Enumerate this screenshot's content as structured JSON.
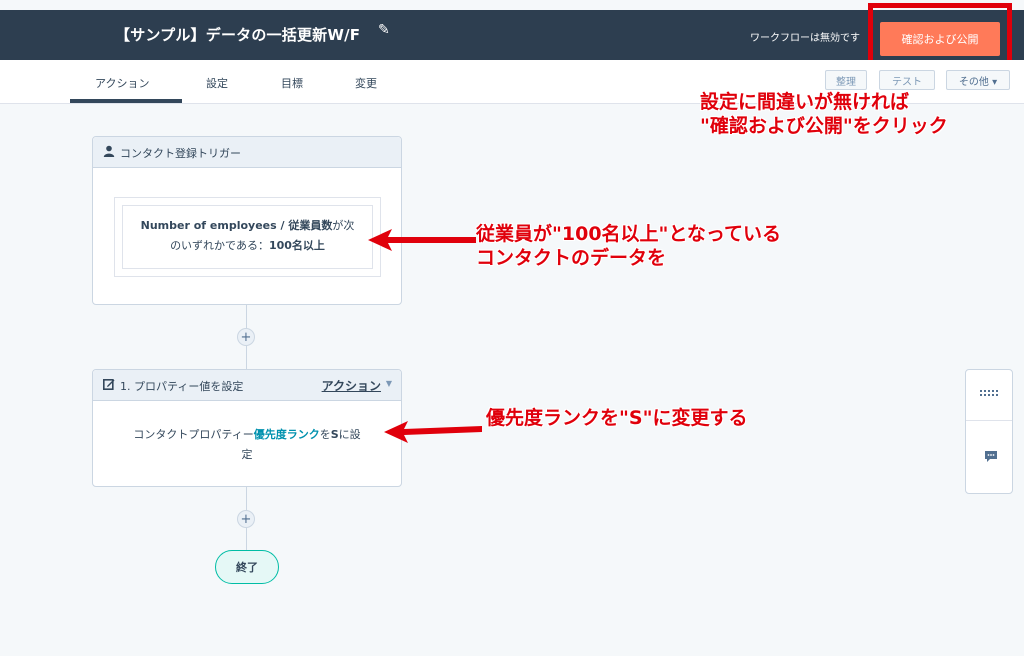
{
  "header": {
    "title": "【サンプル】データの一括更新W/F",
    "edit_icon": "pencil-icon",
    "status": "ワークフローは無効です",
    "publish_label": "確認および公開"
  },
  "tabs": [
    {
      "label": "アクション"
    },
    {
      "label": "設定"
    },
    {
      "label": "目標"
    },
    {
      "label": "変更"
    }
  ],
  "toolbar": {
    "tidy_label": "整理",
    "test_label": "テスト",
    "more_label": "その他 ▾"
  },
  "trigger": {
    "icon": "user-icon",
    "title": "コンタクト登録トリガー",
    "filter_prop": "Number of employees / 従業員数",
    "filter_mid": "が次",
    "filter_line2": "のいずれかである：",
    "filter_value": "100名以上"
  },
  "action": {
    "icon": "edit-icon",
    "title": "1. プロパティー値を設定",
    "menu_label": "アクション",
    "body_pre": "コンタクトプロパティー",
    "body_prop": "優先度ランク",
    "body_mid": "を",
    "body_value": "S",
    "body_post": "に設",
    "body_line2": "定"
  },
  "end_label": "終了",
  "annotations": {
    "publish_line1": "設定に間違いが無ければ",
    "publish_line2": "\"確認および公開\"をクリック",
    "trigger_line1": "従業員が\"100名以上\"となっている",
    "trigger_line2": "コンタクトのデータを",
    "action_line1": "優先度ランクを\"S\"に変更する"
  },
  "colors": {
    "topbar": "#2d3e50",
    "publish": "#ff7a59",
    "annotation": "#e0000b",
    "link_teal": "#0091ae"
  }
}
